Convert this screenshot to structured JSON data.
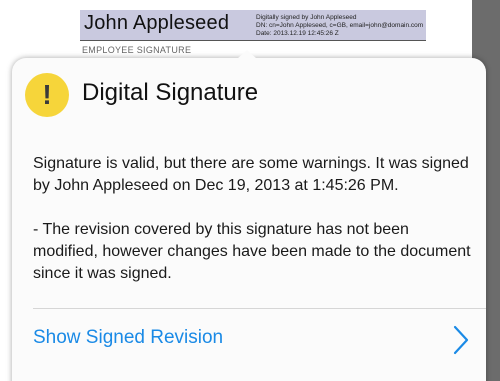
{
  "signature_field": {
    "name": "John Appleseed",
    "details": [
      "Digitally signed by John Appleseed",
      "DN: cn=John Appleseed, c=GB, email=john@domain.com",
      "Date: 2013.12.19 12:45:26 Z"
    ],
    "caption": "EMPLOYEE SIGNATURE"
  },
  "popover": {
    "icon": "warning-exclamation-icon",
    "icon_glyph": "!",
    "icon_color": "#f6d53a",
    "title": "Digital Signature",
    "message": "Signature is valid, but there are some warnings. It was signed by John Appleseed on Dec 19, 2013 at 1:45:26 PM.",
    "warning": "- The revision covered by this signature has not been modified, however changes have been made to the document since it was signed.",
    "action_label": "Show Signed Revision",
    "action_color": "#1a8ae6"
  }
}
